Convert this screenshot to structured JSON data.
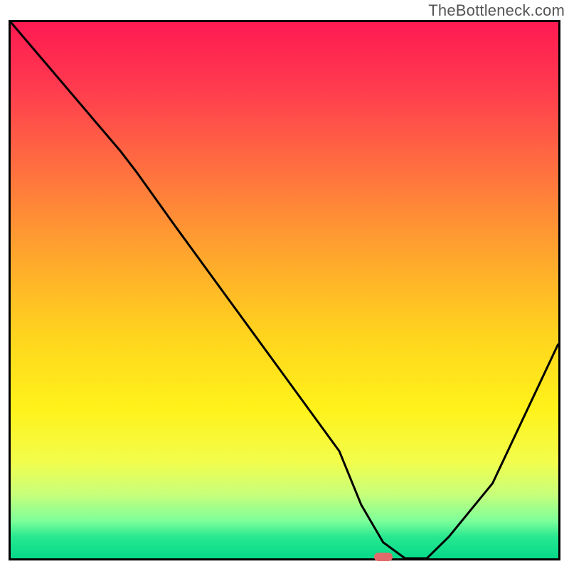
{
  "watermark": "TheBottleneck.com",
  "chart_data": {
    "type": "line",
    "title": "",
    "xlabel": "",
    "ylabel": "",
    "xlim": [
      0,
      100
    ],
    "ylim": [
      0,
      100
    ],
    "grid": false,
    "series": [
      {
        "name": "bottleneck-curve",
        "x": [
          0,
          10,
          20,
          23,
          30,
          40,
          50,
          60,
          64,
          68,
          72,
          76,
          80,
          88,
          100
        ],
        "y": [
          100,
          88,
          76,
          72,
          62,
          48,
          34,
          20,
          10,
          3,
          0,
          0,
          4,
          14,
          40
        ]
      }
    ],
    "marker": {
      "x": 68,
      "y": 0,
      "color": "#e26a6a"
    },
    "gradient_stops": [
      {
        "pct": 0,
        "color": "#ff1a52"
      },
      {
        "pct": 12,
        "color": "#ff3a4f"
      },
      {
        "pct": 26,
        "color": "#ff6b41"
      },
      {
        "pct": 42,
        "color": "#ffa12f"
      },
      {
        "pct": 58,
        "color": "#ffd31e"
      },
      {
        "pct": 72,
        "color": "#fff21a"
      },
      {
        "pct": 82,
        "color": "#f2fd4c"
      },
      {
        "pct": 88,
        "color": "#c8ff7a"
      },
      {
        "pct": 93,
        "color": "#7eff9a"
      },
      {
        "pct": 96,
        "color": "#28e890"
      },
      {
        "pct": 100,
        "color": "#05d98a"
      }
    ]
  }
}
